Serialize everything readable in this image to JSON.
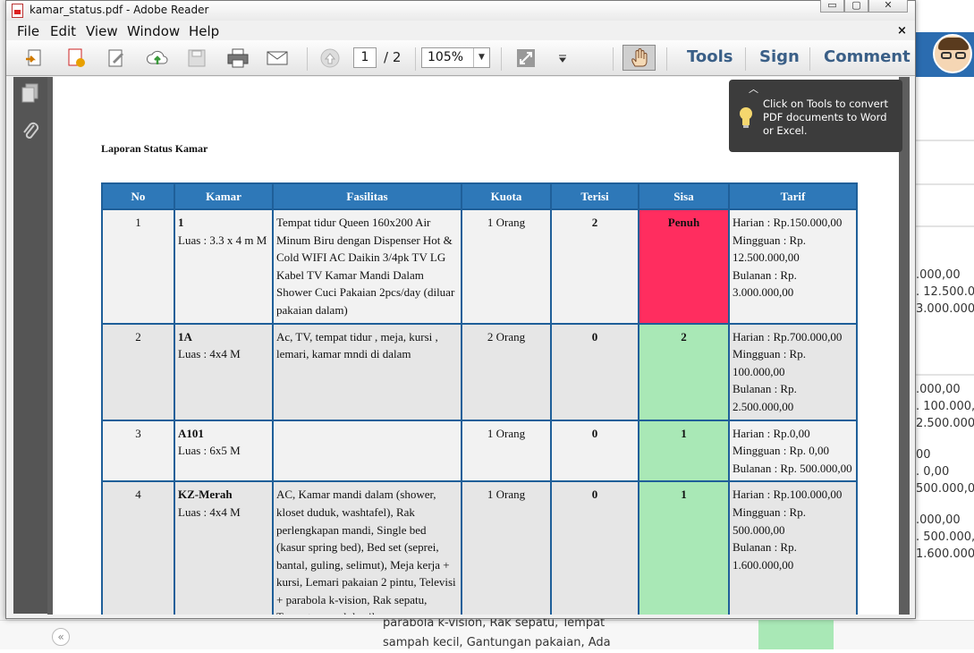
{
  "window": {
    "title": "kamar_status.pdf - Adobe Reader",
    "doc_close": "×",
    "min": "▭",
    "max": "▢",
    "close": "✕"
  },
  "menu": [
    "File",
    "Edit",
    "View",
    "Window",
    "Help"
  ],
  "toolbar": {
    "page_current": "1",
    "page_total": "/ 2",
    "zoom": "105%",
    "zoom_arrow": "▼",
    "tools_label": "Tools",
    "sign_label": "Sign",
    "comment_label": "Comment"
  },
  "tooltip": {
    "text": "Click on Tools to convert PDF documents to Word or Excel."
  },
  "document": {
    "title": "Laporan Status Kamar",
    "columns": [
      "No",
      "Kamar",
      "Fasilitas",
      "Kuota",
      "Terisi",
      "Sisa",
      "Tarif"
    ],
    "rows": [
      {
        "no": "1",
        "kamar": "1",
        "luas": "Luas : 3.3 x 4 m M",
        "fasilitas": "Tempat tidur Queen 160x200 Air Minum Biru dengan Dispenser Hot & Cold WIFI AC Daikin 3/4pk TV LG Kabel TV Kamar Mandi Dalam Shower Cuci Pakaian 2pcs/day (diluar pakaian dalam)",
        "kuota": "1 Orang",
        "terisi": "2",
        "sisa": "Penuh",
        "tarif": [
          "Harian : Rp.150.000,00",
          "Mingguan : Rp. 12.500.000,00",
          "Bulanan : Rp. 3.000.000,00"
        ]
      },
      {
        "no": "2",
        "kamar": "1A",
        "luas": "Luas : 4x4 M",
        "fasilitas": "Ac, TV, tempat tidur , meja, kursi , lemari, kamar mndi di dalam",
        "kuota": "2 Orang",
        "terisi": "0",
        "sisa": "2",
        "tarif": [
          "Harian : Rp.700.000,00",
          "Mingguan : Rp. 100.000,00",
          "Bulanan : Rp. 2.500.000,00"
        ]
      },
      {
        "no": "3",
        "kamar": "A101",
        "luas": "Luas : 6x5 M",
        "fasilitas": "",
        "kuota": "1 Orang",
        "terisi": "0",
        "sisa": "1",
        "tarif": [
          "Harian : Rp.0,00",
          "Mingguan : Rp. 0,00",
          "Bulanan : Rp. 500.000,00"
        ]
      },
      {
        "no": "4",
        "kamar": "KZ-Merah",
        "luas": "Luas : 4x4 M",
        "fasilitas": "AC, Kamar mandi dalam (shower, kloset duduk, washtafel), Rak perlengkapan mandi, Single bed (kasur spring bed), Bed set (seprei, bantal, guling, selimut), Meja kerja + kursi, Lemari pakaian 2 pintu, Televisi + parabola k-vision, Rak sepatu, Tempat sampah kecil,",
        "kuota": "1 Orang",
        "terisi": "0",
        "sisa": "1",
        "tarif": [
          "Harian : Rp.100.000,00",
          "Mingguan : Rp. 500.000,00",
          "Bulanan : Rp. 1.600.000,00"
        ]
      }
    ]
  },
  "background": {
    "right_values": [
      ".000,00",
      ". 12.500.00",
      "3.000.000,0",
      ".000,00",
      ". 100.000,0",
      "2.500.000,0",
      "00",
      ". 0,00",
      "500.000,00",
      ".000,00",
      ". 500.000,0",
      "1.600.000,0"
    ],
    "bottom_text": [
      "parabola k-vision, Rak sepatu, Tempat",
      "sampah kecil, Gantungan pakaian, Ada"
    ],
    "collapse": "«"
  },
  "colors": {
    "header": "#2e78b8",
    "full": "#ff2d5f",
    "available": "#a9e8b6",
    "links": "#3a5f87"
  }
}
